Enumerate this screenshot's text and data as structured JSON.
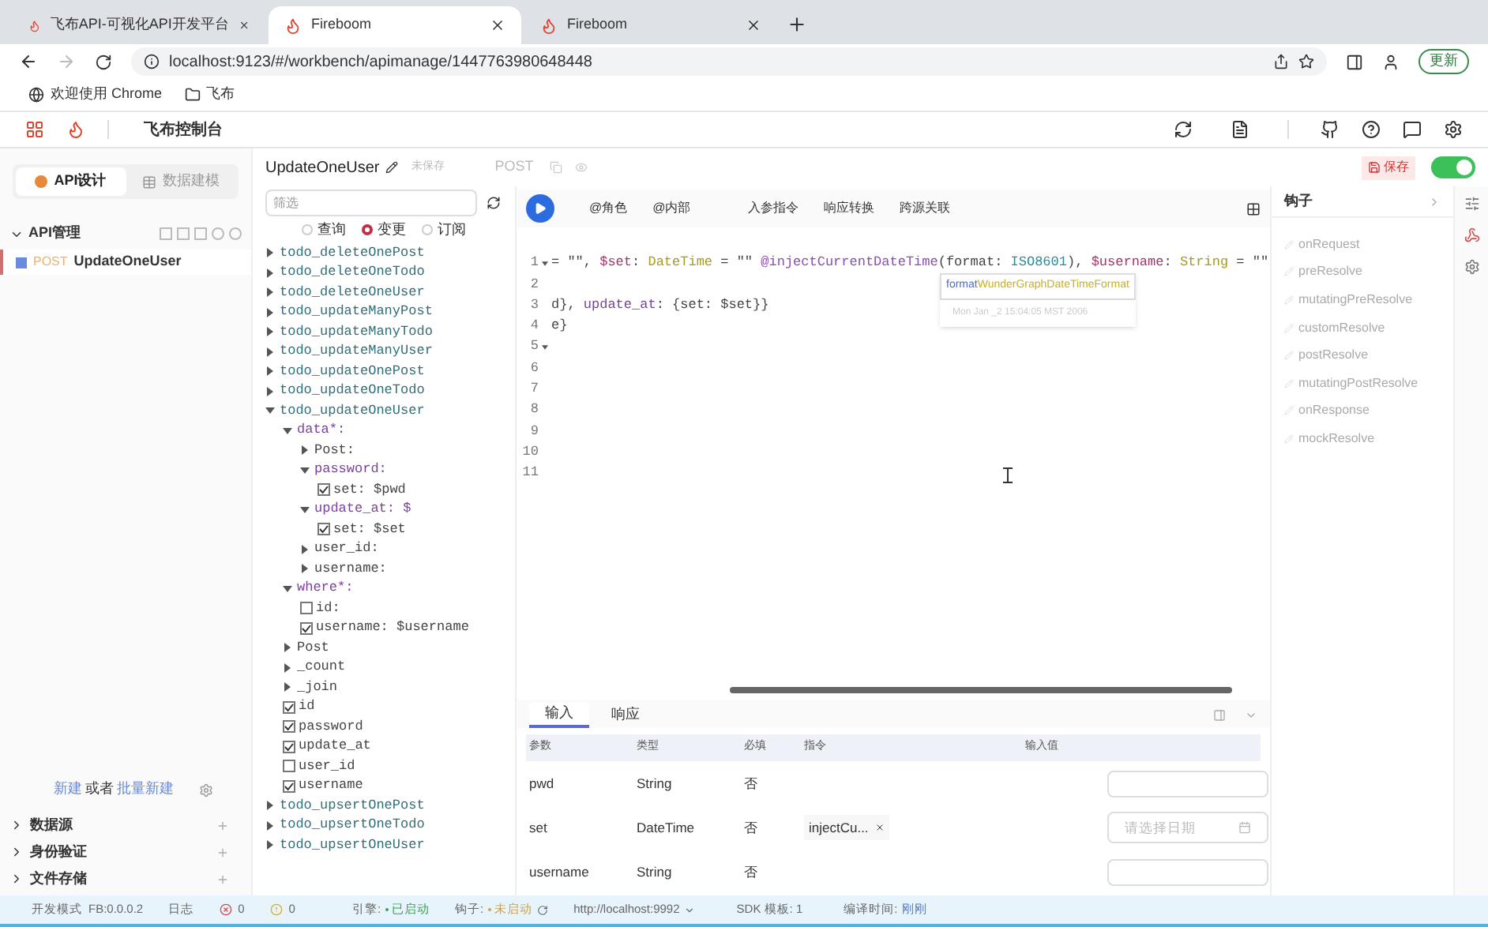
{
  "browser": {
    "tabs": [
      {
        "title": "飞布API-可视化API开发平台",
        "selected": false
      },
      {
        "title": "Fireboom",
        "selected": true
      },
      {
        "title": "Fireboom",
        "selected": false
      }
    ],
    "address": "localhost:9123/#/workbench/apimanage/1447763980648448",
    "update_button": "更新",
    "bookmarks": [
      {
        "label": "欢迎使用 Chrome",
        "kind": "site"
      },
      {
        "label": "飞布",
        "kind": "folder"
      }
    ]
  },
  "app_header": {
    "title": "飞布控制台"
  },
  "sidebar": {
    "tabs": [
      {
        "label": "API设计",
        "selected": true
      },
      {
        "label": "数据建模",
        "selected": false
      }
    ],
    "section": {
      "title": "API管理",
      "expanded": true
    },
    "apis": [
      {
        "method": "POST",
        "name": "UpdateOneUser",
        "selected": true
      }
    ],
    "create_link": "新建",
    "or_text": "或者",
    "batch_link": "批量新建",
    "groups": [
      {
        "label": "数据源",
        "expanded": false
      },
      {
        "label": "身份验证",
        "expanded": false
      },
      {
        "label": "文件存储",
        "expanded": false
      }
    ]
  },
  "api_header": {
    "name": "UpdateOneUser",
    "status": "未保存",
    "method": "POST",
    "save_button": "保存",
    "enabled": true
  },
  "explorer": {
    "filter_placeholder": "筛选",
    "operation_types": [
      {
        "label": "查询",
        "selected": false
      },
      {
        "label": "变更",
        "selected": true
      },
      {
        "label": "订阅",
        "selected": false
      }
    ],
    "tree": [
      {
        "label": "todo_deleteOnePost",
        "kind": "branch",
        "expanded": false
      },
      {
        "label": "todo_deleteOneTodo",
        "kind": "branch",
        "expanded": false
      },
      {
        "label": "todo_deleteOneUser",
        "kind": "branch",
        "expanded": false
      },
      {
        "label": "todo_updateManyPost",
        "kind": "branch",
        "expanded": false
      },
      {
        "label": "todo_updateManyTodo",
        "kind": "branch",
        "expanded": false
      },
      {
        "label": "todo_updateManyUser",
        "kind": "branch",
        "expanded": false
      },
      {
        "label": "todo_updateOnePost",
        "kind": "branch",
        "expanded": false
      },
      {
        "label": "todo_updateOneTodo",
        "kind": "branch",
        "expanded": false
      },
      {
        "label": "todo_updateOneUser",
        "kind": "branch",
        "expanded": true,
        "children": [
          {
            "label": "data*:",
            "kind": "branch",
            "expanded": true,
            "children": [
              {
                "label": "Post:",
                "kind": "branch",
                "expanded": false
              },
              {
                "label": "password:",
                "kind": "branch",
                "expanded": true,
                "children": [
                  {
                    "label": "set: $pwd",
                    "kind": "field",
                    "checked": true
                  }
                ]
              },
              {
                "label": "update_at: $",
                "kind": "branch",
                "expanded": true,
                "children": [
                  {
                    "label": "set: $set",
                    "kind": "field",
                    "checked": true
                  }
                ]
              },
              {
                "label": "user_id:",
                "kind": "branch",
                "expanded": false
              },
              {
                "label": "username:",
                "kind": "branch",
                "expanded": false
              }
            ]
          },
          {
            "label": "where*:",
            "kind": "branch",
            "expanded": true,
            "children": [
              {
                "label": "id:",
                "kind": "field",
                "checked": false
              },
              {
                "label": "username: $username",
                "kind": "field",
                "checked": true
              }
            ]
          },
          {
            "label": "Post",
            "kind": "branch",
            "expanded": false
          },
          {
            "label": "_count",
            "kind": "branch",
            "expanded": false
          },
          {
            "label": "_join",
            "kind": "branch",
            "expanded": false
          },
          {
            "label": "id",
            "kind": "field",
            "checked": true
          },
          {
            "label": "password",
            "kind": "field",
            "checked": true
          },
          {
            "label": "update_at",
            "kind": "field",
            "checked": true
          },
          {
            "label": "user_id",
            "kind": "field",
            "checked": false
          },
          {
            "label": "username",
            "kind": "field",
            "checked": true
          }
        ]
      },
      {
        "label": "todo_upsertOnePost",
        "kind": "branch",
        "expanded": false
      },
      {
        "label": "todo_upsertOneTodo",
        "kind": "branch",
        "expanded": false
      },
      {
        "label": "todo_upsertOneUser",
        "kind": "branch",
        "expanded": false
      }
    ]
  },
  "editor": {
    "toolbar": [
      {
        "label": "@角色"
      },
      {
        "label": "@内部"
      },
      {
        "label": "入参指令"
      },
      {
        "label": "响应转换"
      },
      {
        "label": "跨源关联"
      }
    ],
    "lines": [
      {
        "number": "1",
        "foldable": true,
        "tokens": [
          {
            "text": "= \"\", ",
            "kind": "plain"
          },
          {
            "text": "$set",
            "kind": "var"
          },
          {
            "text": ": ",
            "kind": "plain"
          },
          {
            "text": "DateTime",
            "kind": "type"
          },
          {
            "text": " = \"\" ",
            "kind": "plain"
          },
          {
            "text": "@injectCurrentDateTime",
            "kind": "directive"
          },
          {
            "text": "(format: ",
            "kind": "plain"
          },
          {
            "text": "ISO8601",
            "kind": "enum"
          },
          {
            "text": "), ",
            "kind": "plain"
          },
          {
            "text": "$username",
            "kind": "var"
          },
          {
            "text": ": ",
            "kind": "plain"
          },
          {
            "text": "String",
            "kind": "type"
          },
          {
            "text": " = \"\"",
            "kind": "plain"
          }
        ]
      },
      {
        "number": "2",
        "foldable": false
      },
      {
        "number": "3",
        "foldable": false,
        "tokens": [
          {
            "text": "d}, ",
            "kind": "plain"
          },
          {
            "text": "update_at",
            "kind": "field"
          },
          {
            "text": ": {set: $set}}",
            "kind": "plain"
          }
        ]
      },
      {
        "number": "4",
        "foldable": false,
        "tokens": [
          {
            "text": "e}",
            "kind": "plain"
          }
        ]
      },
      {
        "number": "5",
        "foldable": true
      },
      {
        "number": "6",
        "foldable": false
      },
      {
        "number": "7",
        "foldable": false
      },
      {
        "number": "8",
        "foldable": false
      },
      {
        "number": "9",
        "foldable": false
      },
      {
        "number": "10",
        "foldable": false
      },
      {
        "number": "11",
        "foldable": false
      }
    ],
    "autocomplete": {
      "match": "format",
      "rest": "WunderGraphDateTimeFormat",
      "detail": "Mon Jan _2 15:04:05 MST 2006"
    }
  },
  "params_panel": {
    "tabs": [
      {
        "label": "输入",
        "selected": true
      },
      {
        "label": "响应",
        "selected": false
      }
    ],
    "columns": [
      "参数",
      "类型",
      "必填",
      "指令",
      "输入值"
    ],
    "rows": [
      {
        "name": "pwd",
        "type": "String",
        "required": "否",
        "input": {
          "kind": "text"
        }
      },
      {
        "name": "set",
        "type": "DateTime",
        "required": "否",
        "directive": "injectCu...",
        "input": {
          "kind": "date",
          "placeholder": "请选择日期"
        }
      },
      {
        "name": "username",
        "type": "String",
        "required": "否",
        "input": {
          "kind": "text"
        }
      }
    ]
  },
  "hooks": {
    "title": "钩子",
    "items": [
      "onRequest",
      "preResolve",
      "mutatingPreResolve",
      "customResolve",
      "postResolve",
      "mutatingPostResolve",
      "onResponse",
      "mockResolve"
    ]
  },
  "status_bar": {
    "mode": "开发模式",
    "version": "FB:0.0.0.2",
    "log": "日志",
    "errors": "0",
    "warnings": "0",
    "engine_label": "引擎:",
    "engine_status": "已启动",
    "engine_running": true,
    "hooks_label": "钩子:",
    "hooks_status": "未启动",
    "hooks_running": false,
    "url": "http://localhost:9992",
    "sdk": "SDK 模板: 1",
    "compile_label": "编译时间:",
    "compile_time": "刚刚"
  }
}
